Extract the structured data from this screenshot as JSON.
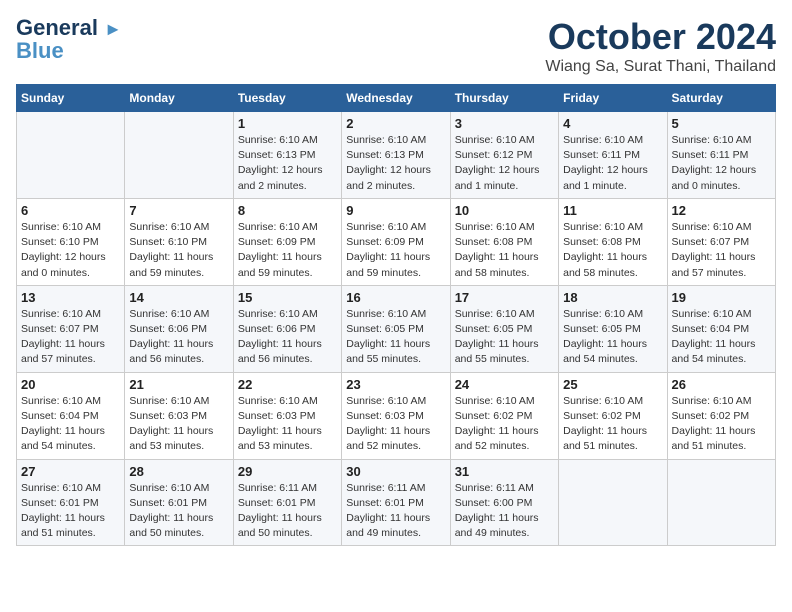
{
  "logo": {
    "general": "General",
    "blue": "Blue",
    "tagline": "▲"
  },
  "title": "October 2024",
  "subtitle": "Wiang Sa, Surat Thani, Thailand",
  "weekdays": [
    "Sunday",
    "Monday",
    "Tuesday",
    "Wednesday",
    "Thursday",
    "Friday",
    "Saturday"
  ],
  "weeks": [
    [
      {
        "day": "",
        "detail": ""
      },
      {
        "day": "",
        "detail": ""
      },
      {
        "day": "1",
        "detail": "Sunrise: 6:10 AM\nSunset: 6:13 PM\nDaylight: 12 hours\nand 2 minutes."
      },
      {
        "day": "2",
        "detail": "Sunrise: 6:10 AM\nSunset: 6:13 PM\nDaylight: 12 hours\nand 2 minutes."
      },
      {
        "day": "3",
        "detail": "Sunrise: 6:10 AM\nSunset: 6:12 PM\nDaylight: 12 hours\nand 1 minute."
      },
      {
        "day": "4",
        "detail": "Sunrise: 6:10 AM\nSunset: 6:11 PM\nDaylight: 12 hours\nand 1 minute."
      },
      {
        "day": "5",
        "detail": "Sunrise: 6:10 AM\nSunset: 6:11 PM\nDaylight: 12 hours\nand 0 minutes."
      }
    ],
    [
      {
        "day": "6",
        "detail": "Sunrise: 6:10 AM\nSunset: 6:10 PM\nDaylight: 12 hours\nand 0 minutes."
      },
      {
        "day": "7",
        "detail": "Sunrise: 6:10 AM\nSunset: 6:10 PM\nDaylight: 11 hours\nand 59 minutes."
      },
      {
        "day": "8",
        "detail": "Sunrise: 6:10 AM\nSunset: 6:09 PM\nDaylight: 11 hours\nand 59 minutes."
      },
      {
        "day": "9",
        "detail": "Sunrise: 6:10 AM\nSunset: 6:09 PM\nDaylight: 11 hours\nand 59 minutes."
      },
      {
        "day": "10",
        "detail": "Sunrise: 6:10 AM\nSunset: 6:08 PM\nDaylight: 11 hours\nand 58 minutes."
      },
      {
        "day": "11",
        "detail": "Sunrise: 6:10 AM\nSunset: 6:08 PM\nDaylight: 11 hours\nand 58 minutes."
      },
      {
        "day": "12",
        "detail": "Sunrise: 6:10 AM\nSunset: 6:07 PM\nDaylight: 11 hours\nand 57 minutes."
      }
    ],
    [
      {
        "day": "13",
        "detail": "Sunrise: 6:10 AM\nSunset: 6:07 PM\nDaylight: 11 hours\nand 57 minutes."
      },
      {
        "day": "14",
        "detail": "Sunrise: 6:10 AM\nSunset: 6:06 PM\nDaylight: 11 hours\nand 56 minutes."
      },
      {
        "day": "15",
        "detail": "Sunrise: 6:10 AM\nSunset: 6:06 PM\nDaylight: 11 hours\nand 56 minutes."
      },
      {
        "day": "16",
        "detail": "Sunrise: 6:10 AM\nSunset: 6:05 PM\nDaylight: 11 hours\nand 55 minutes."
      },
      {
        "day": "17",
        "detail": "Sunrise: 6:10 AM\nSunset: 6:05 PM\nDaylight: 11 hours\nand 55 minutes."
      },
      {
        "day": "18",
        "detail": "Sunrise: 6:10 AM\nSunset: 6:05 PM\nDaylight: 11 hours\nand 54 minutes."
      },
      {
        "day": "19",
        "detail": "Sunrise: 6:10 AM\nSunset: 6:04 PM\nDaylight: 11 hours\nand 54 minutes."
      }
    ],
    [
      {
        "day": "20",
        "detail": "Sunrise: 6:10 AM\nSunset: 6:04 PM\nDaylight: 11 hours\nand 54 minutes."
      },
      {
        "day": "21",
        "detail": "Sunrise: 6:10 AM\nSunset: 6:03 PM\nDaylight: 11 hours\nand 53 minutes."
      },
      {
        "day": "22",
        "detail": "Sunrise: 6:10 AM\nSunset: 6:03 PM\nDaylight: 11 hours\nand 53 minutes."
      },
      {
        "day": "23",
        "detail": "Sunrise: 6:10 AM\nSunset: 6:03 PM\nDaylight: 11 hours\nand 52 minutes."
      },
      {
        "day": "24",
        "detail": "Sunrise: 6:10 AM\nSunset: 6:02 PM\nDaylight: 11 hours\nand 52 minutes."
      },
      {
        "day": "25",
        "detail": "Sunrise: 6:10 AM\nSunset: 6:02 PM\nDaylight: 11 hours\nand 51 minutes."
      },
      {
        "day": "26",
        "detail": "Sunrise: 6:10 AM\nSunset: 6:02 PM\nDaylight: 11 hours\nand 51 minutes."
      }
    ],
    [
      {
        "day": "27",
        "detail": "Sunrise: 6:10 AM\nSunset: 6:01 PM\nDaylight: 11 hours\nand 51 minutes."
      },
      {
        "day": "28",
        "detail": "Sunrise: 6:10 AM\nSunset: 6:01 PM\nDaylight: 11 hours\nand 50 minutes."
      },
      {
        "day": "29",
        "detail": "Sunrise: 6:11 AM\nSunset: 6:01 PM\nDaylight: 11 hours\nand 50 minutes."
      },
      {
        "day": "30",
        "detail": "Sunrise: 6:11 AM\nSunset: 6:01 PM\nDaylight: 11 hours\nand 49 minutes."
      },
      {
        "day": "31",
        "detail": "Sunrise: 6:11 AM\nSunset: 6:00 PM\nDaylight: 11 hours\nand 49 minutes."
      },
      {
        "day": "",
        "detail": ""
      },
      {
        "day": "",
        "detail": ""
      }
    ]
  ]
}
